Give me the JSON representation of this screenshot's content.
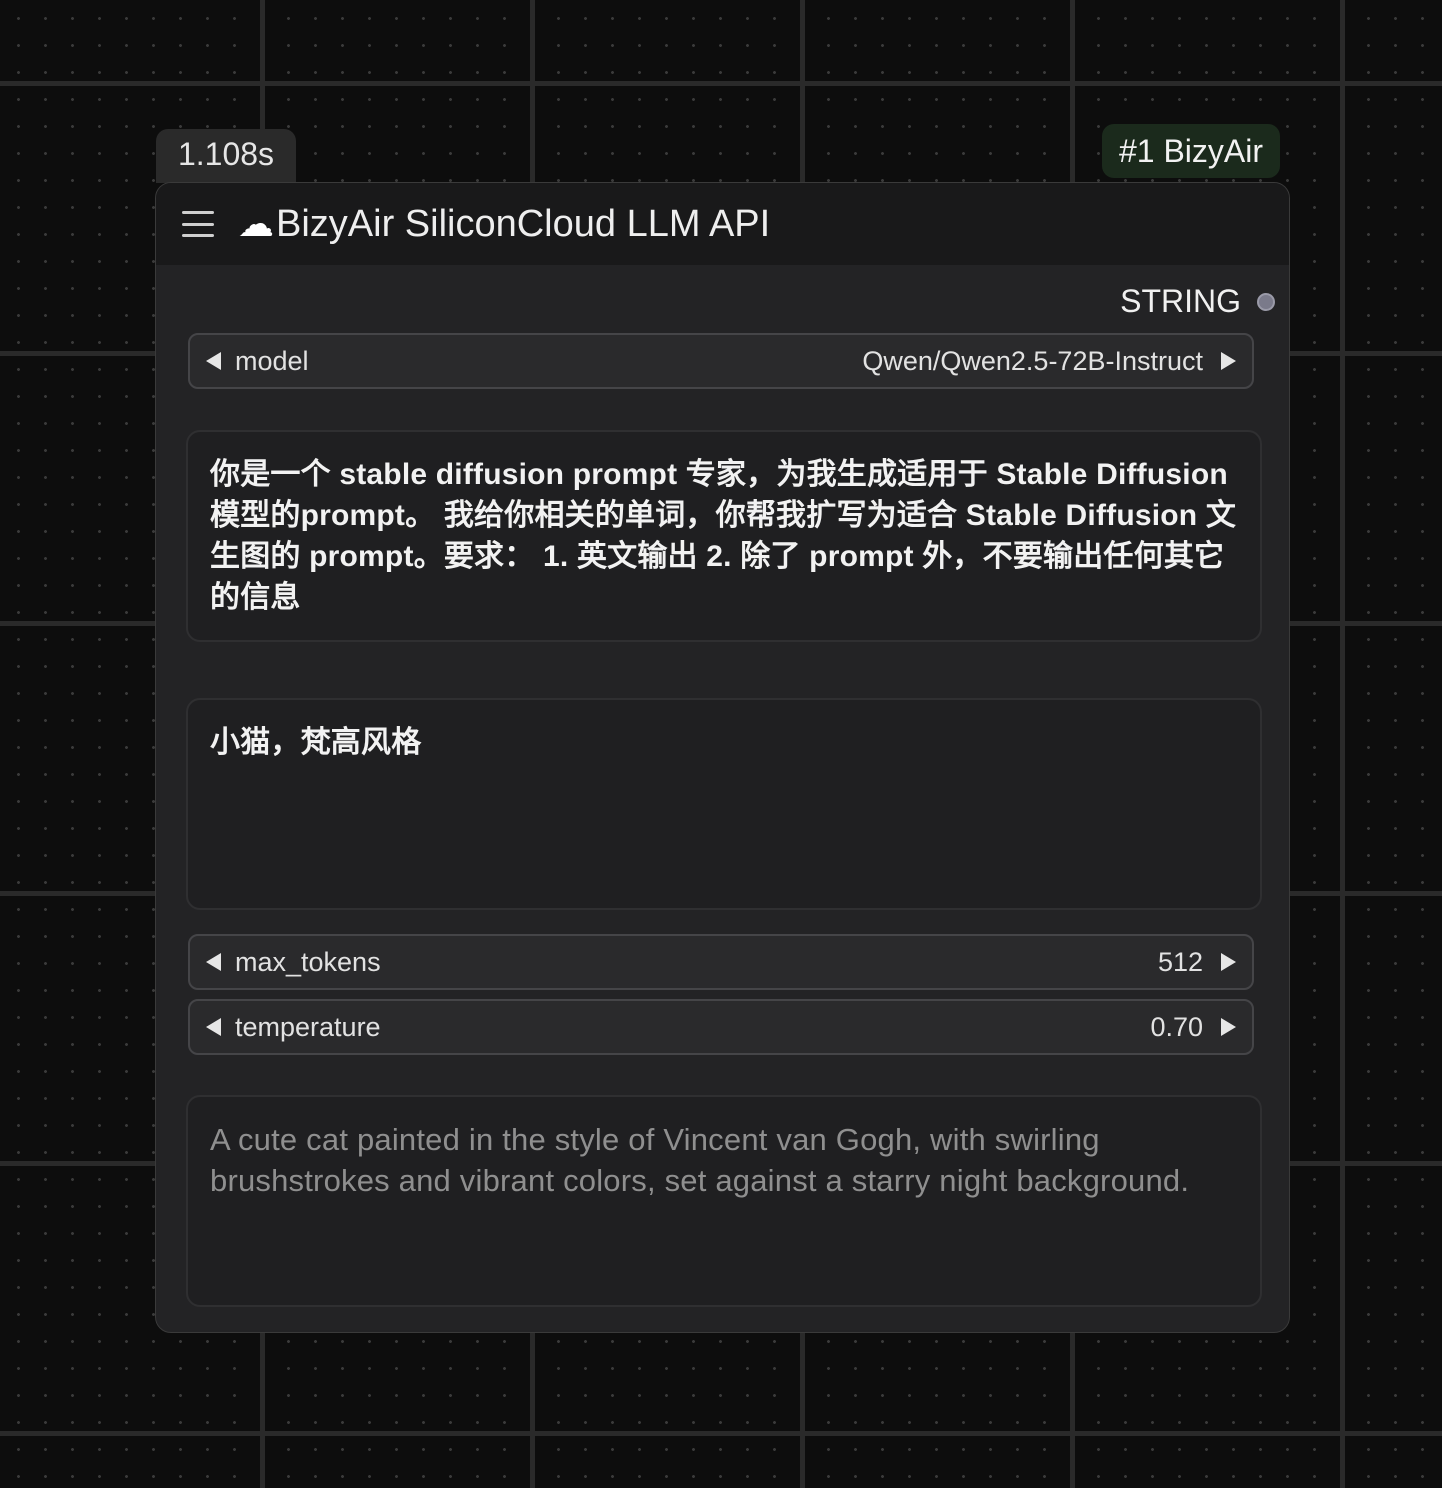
{
  "timing": "1.108s",
  "group_badge": "#1 BizyAir",
  "node": {
    "title_icon": "☁",
    "title": "BizyAir SiliconCloud LLM API",
    "output_label": "STRING",
    "model": {
      "label": "model",
      "value": "Qwen/Qwen2.5-72B-Instruct"
    },
    "system_prompt": "你是一个 stable diffusion prompt 专家，为我生成适用于 Stable Diffusion 模型的prompt。 我给你相关的单词，你帮我扩写为适合 Stable Diffusion 文生图的 prompt。要求： 1. 英文输出 2. 除了 prompt 外，不要输出任何其它的信息",
    "user_prompt": "小猫，梵高风格",
    "max_tokens": {
      "label": "max_tokens",
      "value": "512"
    },
    "temperature": {
      "label": "temperature",
      "value": "0.70"
    },
    "output_text": "A cute cat painted in the style of Vincent van Gogh, with swirling brushstrokes and vibrant colors, set against a starry night background."
  }
}
